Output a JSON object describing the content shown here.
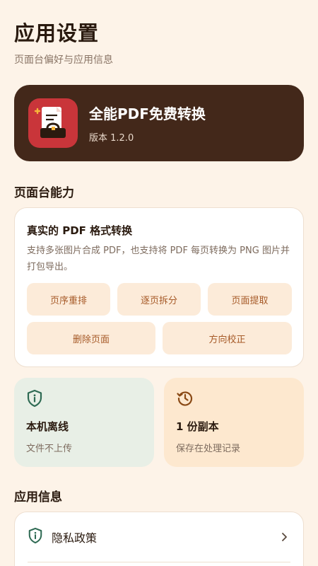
{
  "header": {
    "title": "应用设置",
    "subtitle": "页面台偏好与应用信息"
  },
  "app": {
    "name": "全能PDF免费转换",
    "version": "版本 1.2.0",
    "icon": "pdf-converter-app-icon"
  },
  "capabilities": {
    "section_title": "页面台能力",
    "card_title": "真实的 PDF 格式转换",
    "card_desc": "支持多张图片合成 PDF，也支持将 PDF 每页转换为 PNG 图片并打包导出。",
    "chips": [
      "页序重排",
      "逐页拆分",
      "页面提取",
      "删除页面",
      "方向校正"
    ]
  },
  "stats": [
    {
      "title": "本机离线",
      "sub": "文件不上传",
      "icon": "shield-info-icon",
      "bg": "#E8EFE6",
      "icon_color": "#2E6A53"
    },
    {
      "title": "1 份副本",
      "sub": "保存在处理记录",
      "icon": "history-icon",
      "bg": "#FDE8CF",
      "icon_color": "#8A4A16"
    }
  ],
  "app_info": {
    "section_title": "应用信息",
    "rows": [
      {
        "label": "隐私政策",
        "icon": "shield-info-icon"
      }
    ]
  },
  "colors": {
    "background": "#FDF3E8",
    "app_card": "#43281A",
    "app_icon": "#C9353A",
    "chip_bg": "#FCEBD9",
    "chip_text": "#A65A28"
  }
}
